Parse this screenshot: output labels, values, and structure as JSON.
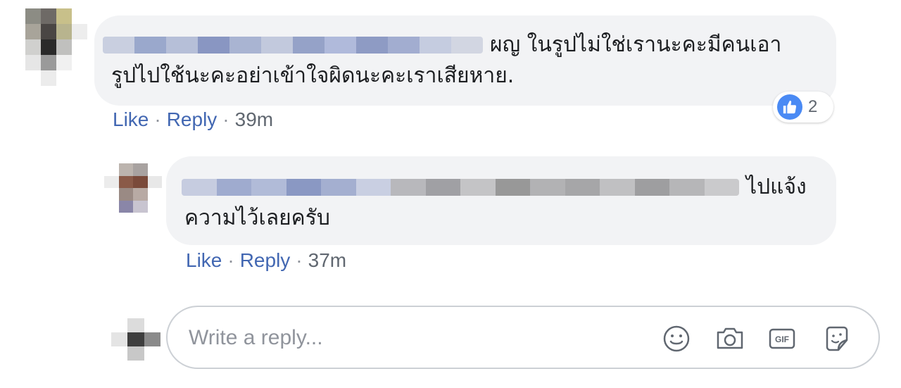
{
  "comments": [
    {
      "text_line1": "ผญ  ในรูปไม่ใช่เรานะคะมีคนเอา",
      "text_line2": "รูปไปใช้นะคะอย่าเข้าใจผิดนะคะเราเสียหาย.",
      "actions": {
        "like": "Like",
        "separator": "·",
        "reply": "Reply",
        "time": "39m"
      },
      "reaction": {
        "icon": "thumbs-up-icon",
        "count": "2",
        "color": "#4a8af4"
      }
    },
    {
      "text_line1": "ไปแจ้ง",
      "text_line2": "ความไว้เลยครับ",
      "actions": {
        "like": "Like",
        "separator": "·",
        "reply": "Reply",
        "time": "37m"
      }
    }
  ],
  "reply_box": {
    "placeholder": "Write a reply...",
    "tools": [
      "emoji-icon",
      "camera-icon",
      "gif-icon",
      "sticker-icon"
    ]
  },
  "colors": {
    "link": "#4267b2",
    "meta": "#606770",
    "bubble": "#f2f3f5",
    "border": "#ccd0d5"
  }
}
